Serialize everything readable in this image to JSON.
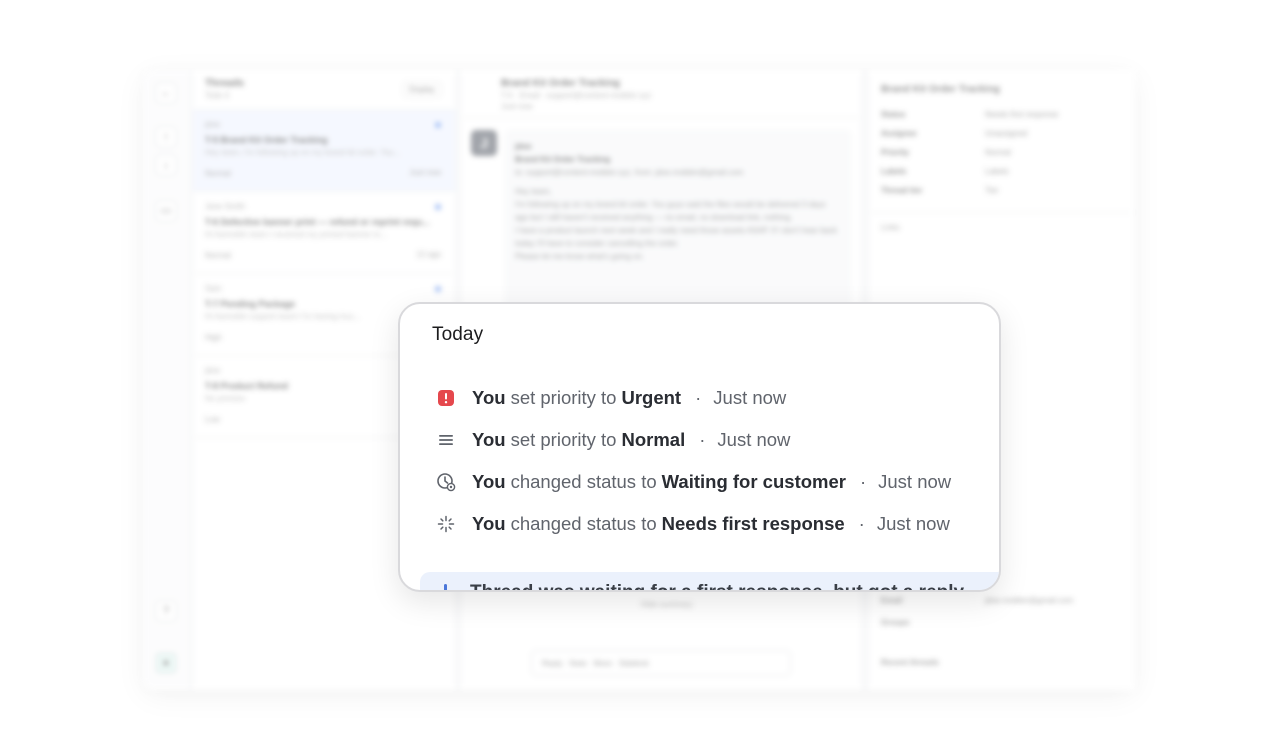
{
  "background": {
    "threads_header": {
      "title": "Threads",
      "subtitle": "Todo 4",
      "display_label": "Display"
    },
    "threads": [
      {
        "who": "jdoe",
        "id": "T-5",
        "title": "Brand Kit Order Tracking",
        "preview": "Hey team, I'm following up on my brand kit order. You...",
        "priority": "Normal",
        "time": "Just now"
      },
      {
        "who": "Jane Smith",
        "id": "T-6",
        "title": "Defective banner print — refund or reprint requ...",
        "preview": "Hi Aamoblin team I received my printed banner to...",
        "priority": "Normal",
        "time": "12 ago"
      },
      {
        "who": "Sam",
        "id": "T-7",
        "title": "Pending Package",
        "preview": "Hi Aamoblin support team! I'm having trou...",
        "priority": "High",
        "time": ""
      },
      {
        "who": "jdoe",
        "id": "T-8",
        "title": "Product Refund",
        "preview": "No preview",
        "priority": "Low",
        "time": ""
      }
    ],
    "conversation": {
      "title": "Brand Kit Order Tracking",
      "subtitle": "T-5 · Email - support@content-mobbin.xyz",
      "time": "Just now",
      "avatar": "J",
      "sender": "jdoe",
      "msg_title": "Brand Kit Order Tracking",
      "msg_to": "to: support@content-mobbin.xyz, from: jdoe.mobbin@gmail.com",
      "body_1": "Hey team,",
      "body_2": "I'm following up on my brand kit order. You guys said the files would be delivered 3 days ago but I still haven't received anything — no email, no download link, nothing.",
      "body_3": "I have a product launch next week and I really need those assets ASAP. If I don't hear back today I'll have to consider cancelling the order.",
      "body_4": "Please let me know what's going on.",
      "hide_summary": "Hide summary",
      "composer": "Reply · Note · More · Sidekick"
    },
    "sidebar": {
      "title": "Brand Kit Order Tracking",
      "rows": [
        {
          "k": "Status",
          "v": "Needs first response"
        },
        {
          "k": "Assignee",
          "v": "Unassigned"
        },
        {
          "k": "Priority",
          "v": "Normal"
        },
        {
          "k": "Labels",
          "v": "Labels"
        },
        {
          "k": "Thread tier",
          "v": "Tier"
        }
      ],
      "links": "Links",
      "email_label": "Email",
      "email_value": "jdoe.mobbin@gmail.com",
      "groups_label": "Groups",
      "recent": "Recent threads"
    }
  },
  "activity": {
    "heading": "Today",
    "events": [
      {
        "icon": "urgent-priority-icon",
        "actor": "You",
        "action": "set priority to",
        "value": "Urgent",
        "time": "Just now"
      },
      {
        "icon": "normal-priority-icon",
        "actor": "You",
        "action": "set priority to",
        "value": "Normal",
        "time": "Just now"
      },
      {
        "icon": "waiting-status-icon",
        "actor": "You",
        "action": "changed status to",
        "value": "Waiting for customer",
        "time": "Just now"
      },
      {
        "icon": "needs-response-status-icon",
        "actor": "You",
        "action": "changed status to",
        "value": "Needs first response",
        "time": "Just now"
      }
    ],
    "separator": "·",
    "pending_text": "Thread was waiting for a first response, but got a reply",
    "colors": {
      "urgent": "#e5484d",
      "accent": "#4a76d9",
      "highlight": "#ebf1fc"
    }
  }
}
